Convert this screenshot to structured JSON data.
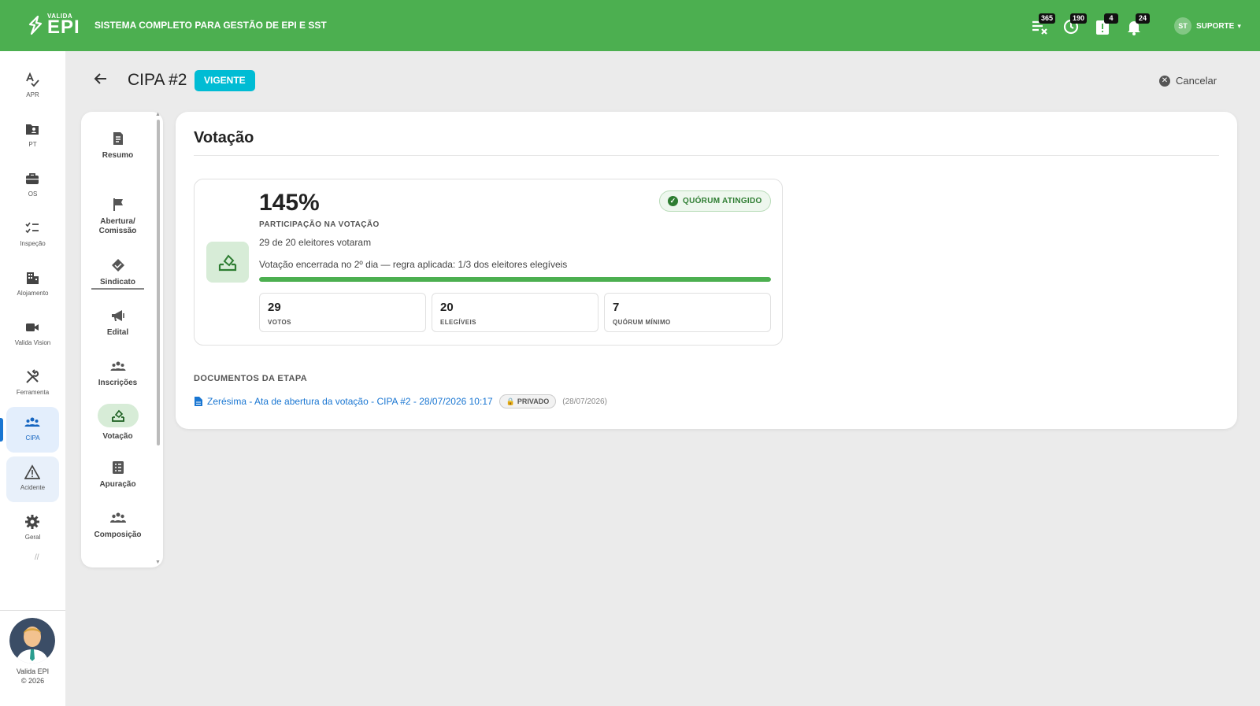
{
  "app": {
    "logo_small": "VALIDA",
    "logo_big": "EPI",
    "subtitle": "SISTEMA COMPLETO PARA GESTÃO DE EPI E SST",
    "brand_color": "#4caf50"
  },
  "topbar": {
    "icons": [
      {
        "name": "task-list-icon",
        "badge": "365"
      },
      {
        "name": "history-clock-icon",
        "badge": "190"
      },
      {
        "name": "clipboard-alert-icon",
        "badge": "4"
      },
      {
        "name": "bell-icon",
        "badge": "24"
      }
    ],
    "user": {
      "initials": "ST",
      "name": "SUPORTE"
    }
  },
  "sidebar": {
    "items": [
      {
        "label": "APR",
        "icon": "spellcheck-icon"
      },
      {
        "label": "PT",
        "icon": "folder-user-icon"
      },
      {
        "label": "OS",
        "icon": "briefcase-icon"
      },
      {
        "label": "Inspeção",
        "icon": "checklist-icon"
      },
      {
        "label": "Alojamento",
        "icon": "building-icon"
      },
      {
        "label": "Valida Vision",
        "icon": "video-camera-icon"
      },
      {
        "label": "Ferramenta",
        "icon": "tools-icon"
      },
      {
        "label": "CIPA",
        "icon": "group-icon",
        "active": true
      },
      {
        "label": "Acidente",
        "icon": "warning-icon"
      },
      {
        "label": "Geral",
        "icon": "gear-icon"
      }
    ],
    "footer_name": "Valida EPI",
    "footer_year": "© 2026"
  },
  "header": {
    "title": "CIPA #2",
    "status": "VIGENTE",
    "cancel_label": "Cancelar"
  },
  "steps": [
    {
      "label": "Resumo",
      "icon": "summary-icon"
    },
    {
      "label": "Abertura/\nComissão",
      "icon": "flag-icon"
    },
    {
      "label": "Sindicato",
      "icon": "handshake-icon"
    },
    {
      "label": "Edital",
      "icon": "megaphone-icon"
    },
    {
      "label": "Inscrições",
      "icon": "people-icon"
    },
    {
      "label": "Votação",
      "icon": "ballot-icon",
      "active": true
    },
    {
      "label": "Apuração",
      "icon": "tally-icon"
    },
    {
      "label": "Composição",
      "icon": "team-icon"
    }
  ],
  "main": {
    "title": "Votação",
    "vote": {
      "percent": "145%",
      "caption": "PARTICIPAÇÃO NA VOTAÇÃO",
      "count_text": "29 de 20 eleitores votaram",
      "rule_text": "Votação encerrada no 2º dia — regra aplicada: 1/3 dos eleitores elegíveis",
      "quorum_badge": "QUÓRUM ATINGIDO",
      "progress": 1.0,
      "stats": [
        {
          "value": "29",
          "label": "VOTOS"
        },
        {
          "value": "20",
          "label": "ELEGÍVEIS"
        },
        {
          "value": "7",
          "label": "QUÓRUM MÍNIMO"
        }
      ]
    },
    "documents": {
      "title": "DOCUMENTOS DA ETAPA",
      "items": [
        {
          "name": "Zerésima - Ata de abertura da votação - CIPA #2 - 28/07/2026 10:17",
          "visibility": "PRIVADO",
          "date": "(28/07/2026)"
        }
      ]
    }
  }
}
